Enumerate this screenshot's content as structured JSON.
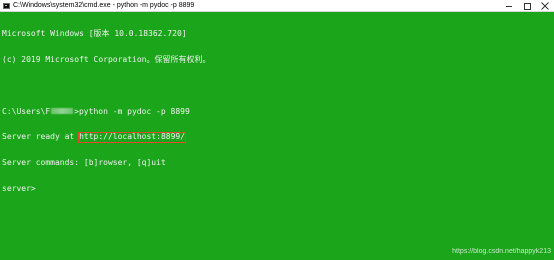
{
  "window": {
    "title": "C:\\Windows\\system32\\cmd.exe - python  -m pydoc -p 8899",
    "icon": "cmd-icon",
    "background": "#1aa51a",
    "text_color": "#f2f2f2"
  },
  "terminal": {
    "line1": "Microsoft Windows [版本 10.0.18362.720]",
    "line2": "(c) 2019 Microsoft Corporation。保留所有权利。",
    "prompt_prefix": "C:\\Users\\F",
    "prompt_suffix": ">python -m pydoc -p 8899",
    "server_ready_prefix": "Server ready at ",
    "server_url": "http://localhost:8899/",
    "server_commands": "Server commands: [b]rowser, [q]uit",
    "server_prompt": "server>"
  },
  "watermark": "https://blog.csdn.net/happyk213"
}
